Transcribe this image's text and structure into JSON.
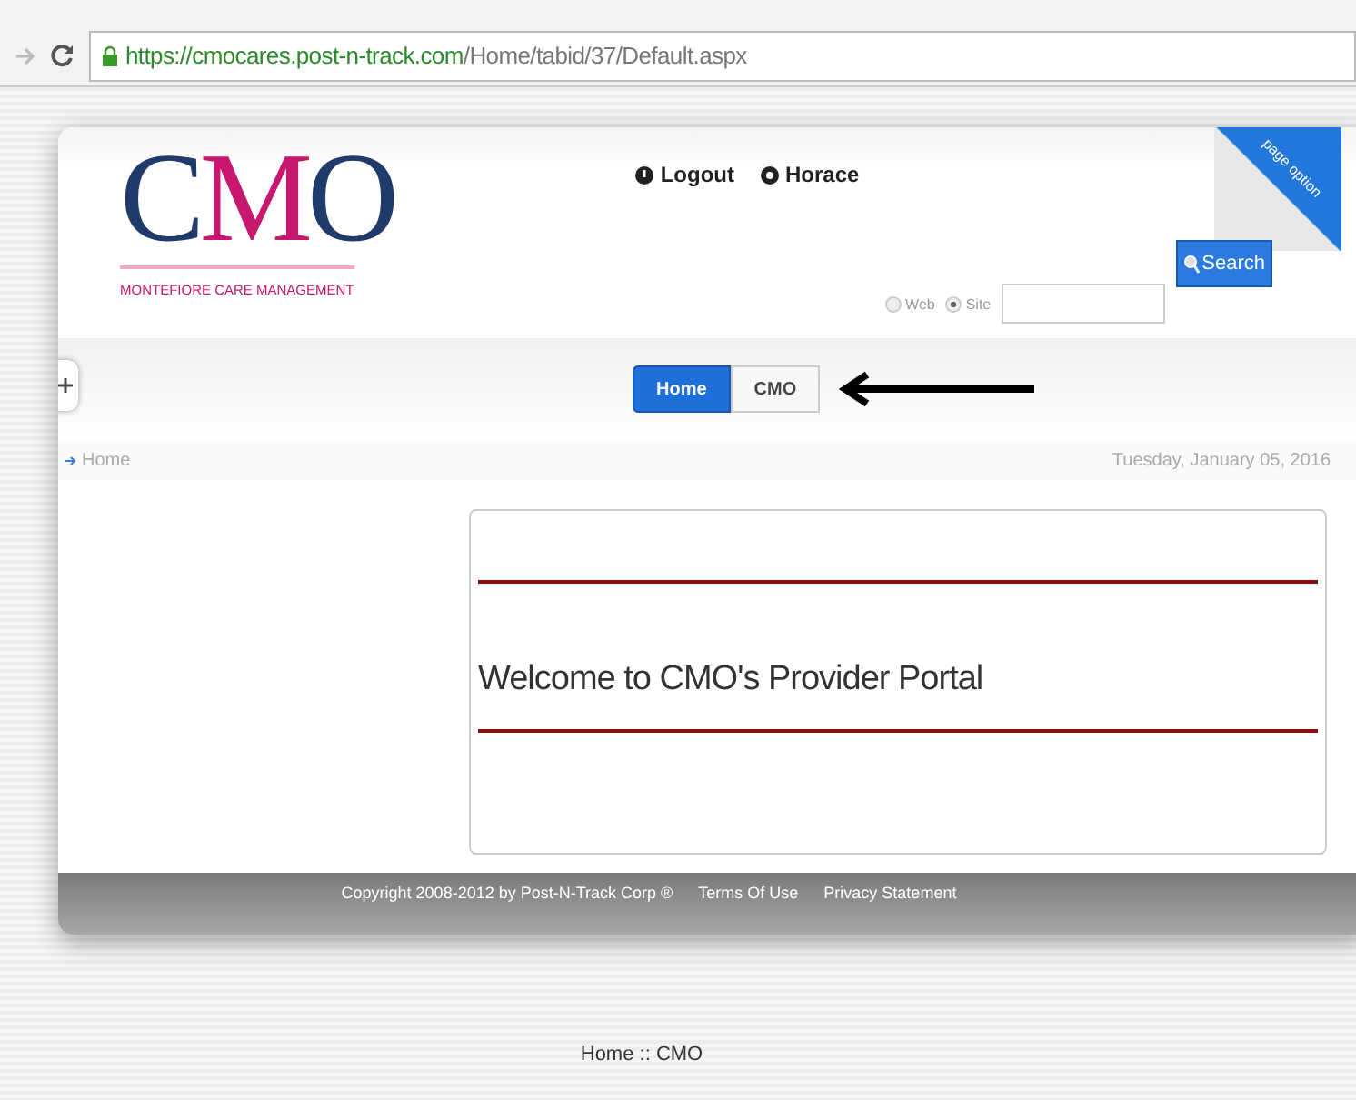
{
  "browser": {
    "url_parts": [
      {
        "text": "https://cmocares.post-n-track.com",
        "kind": "secure"
      },
      {
        "text": "/Home/tabid/37/Default.aspx",
        "kind": "path"
      }
    ]
  },
  "logo": {
    "letters": [
      {
        "text": "C",
        "color": "#1f3a6b"
      },
      {
        "text": "M",
        "color": "#c8176e"
      },
      {
        "text": "O",
        "color": "#1f3a6b"
      }
    ],
    "tagline": "MONTEFIORE CARE MANAGEMENT"
  },
  "user_links": [
    {
      "label": "Logout",
      "kind": "logout"
    },
    {
      "label": "Horace",
      "kind": "user"
    }
  ],
  "page_options": "page option",
  "search": {
    "options": [
      {
        "label": "Web",
        "selected": false
      },
      {
        "label": "Site",
        "selected": true
      }
    ],
    "button": "Search"
  },
  "nav_tabs": [
    {
      "label": "Home",
      "selected": true
    },
    {
      "label": "CMO",
      "selected": false
    }
  ],
  "breadcrumb": "Home",
  "date": "Tuesday, January 05, 2016",
  "welcome": "Welcome to CMO's Provider Portal",
  "footer": {
    "copyright": "Copyright 2008-2012 by Post-N-Track Corp ®",
    "links": [
      "Terms Of Use",
      "Privacy Statement"
    ]
  },
  "bottom_breadcrumb": "Home :: CMO"
}
